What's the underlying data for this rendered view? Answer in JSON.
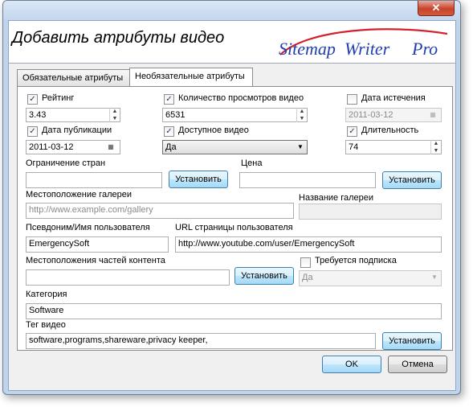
{
  "window": {
    "title": "Добавить атрибуты видео",
    "close_glyph": "✕"
  },
  "logo": {
    "text_sitemap": "Sitemap",
    "text_writer": "Writer",
    "text_pro": "Pro"
  },
  "tabs": [
    {
      "label": "Обязательные атрибуты"
    },
    {
      "label": "Необязательные атрибуты"
    }
  ],
  "rating": {
    "label": "Рейтинг",
    "checked": true,
    "value": "3.43"
  },
  "views": {
    "label": "Количество просмотров видео",
    "checked": true,
    "value": "6531"
  },
  "expiration": {
    "label": "Дата истечения",
    "checked": false,
    "value": "2011-03-12"
  },
  "publication": {
    "label": "Дата публикации",
    "checked": true,
    "value": "2011-03-12"
  },
  "available": {
    "label": "Доступное видео",
    "checked": true,
    "value": "Да"
  },
  "duration": {
    "label": "Длительность",
    "checked": true,
    "value": "74"
  },
  "country_restriction": {
    "label": "Ограничение стран",
    "value": "",
    "button": "Установить"
  },
  "price": {
    "label": "Цена",
    "value": "",
    "button": "Установить"
  },
  "gallery_location": {
    "label": "Местоположение галереи",
    "placeholder": "http://www.example.com/gallery"
  },
  "gallery_name": {
    "label": "Название галереи",
    "value": ""
  },
  "uploader": {
    "label": "Псевдоним/Имя пользователя",
    "value": "EmergencySoft"
  },
  "uploader_url": {
    "label": "URL страницы пользователя",
    "value": "http://www.youtube.com/user/EmergencySoft"
  },
  "content_segments": {
    "label": "Местоположения частей контента",
    "value": "",
    "button": "Установить"
  },
  "subscription": {
    "label": "Требуется подписка",
    "checked": false,
    "value": "Да"
  },
  "category": {
    "label": "Категория",
    "value": "Software"
  },
  "tags": {
    "label": "Тег видео",
    "value": "software,programs,shareware,privacy keeper,",
    "button": "Установить"
  },
  "footer": {
    "ok": "OK",
    "cancel": "Отмена"
  },
  "glyphs": {
    "check": "✓",
    "up": "▲",
    "down": "▼",
    "calendar": "▦"
  },
  "colors": {
    "logo_blue": "#1f3fae",
    "logo_red": "#d3202a"
  }
}
